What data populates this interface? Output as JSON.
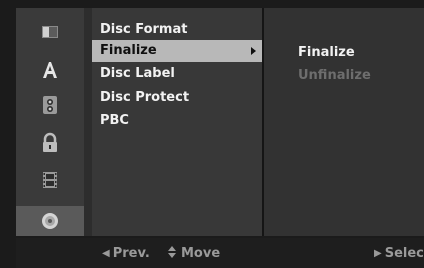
{
  "sidebar": {
    "icons": [
      "display-icon",
      "language-icon",
      "audio-icon",
      "lock-icon",
      "film-icon",
      "disc-icon"
    ],
    "active": "disc-icon"
  },
  "menu": {
    "items": [
      {
        "label": "Disc Format"
      },
      {
        "label": "Finalize",
        "selected": true
      },
      {
        "label": "Disc Label"
      },
      {
        "label": "Disc Protect"
      },
      {
        "label": "PBC"
      }
    ]
  },
  "submenu": {
    "items": [
      {
        "label": "Finalize",
        "enabled": true
      },
      {
        "label": "Unfinalize",
        "enabled": false
      }
    ]
  },
  "footer": {
    "prev": "Prev.",
    "move": "Move",
    "select": "Selec"
  },
  "colors": {
    "selected_bg": "#b8b8b8",
    "disabled_text": "#6e6e6e"
  }
}
